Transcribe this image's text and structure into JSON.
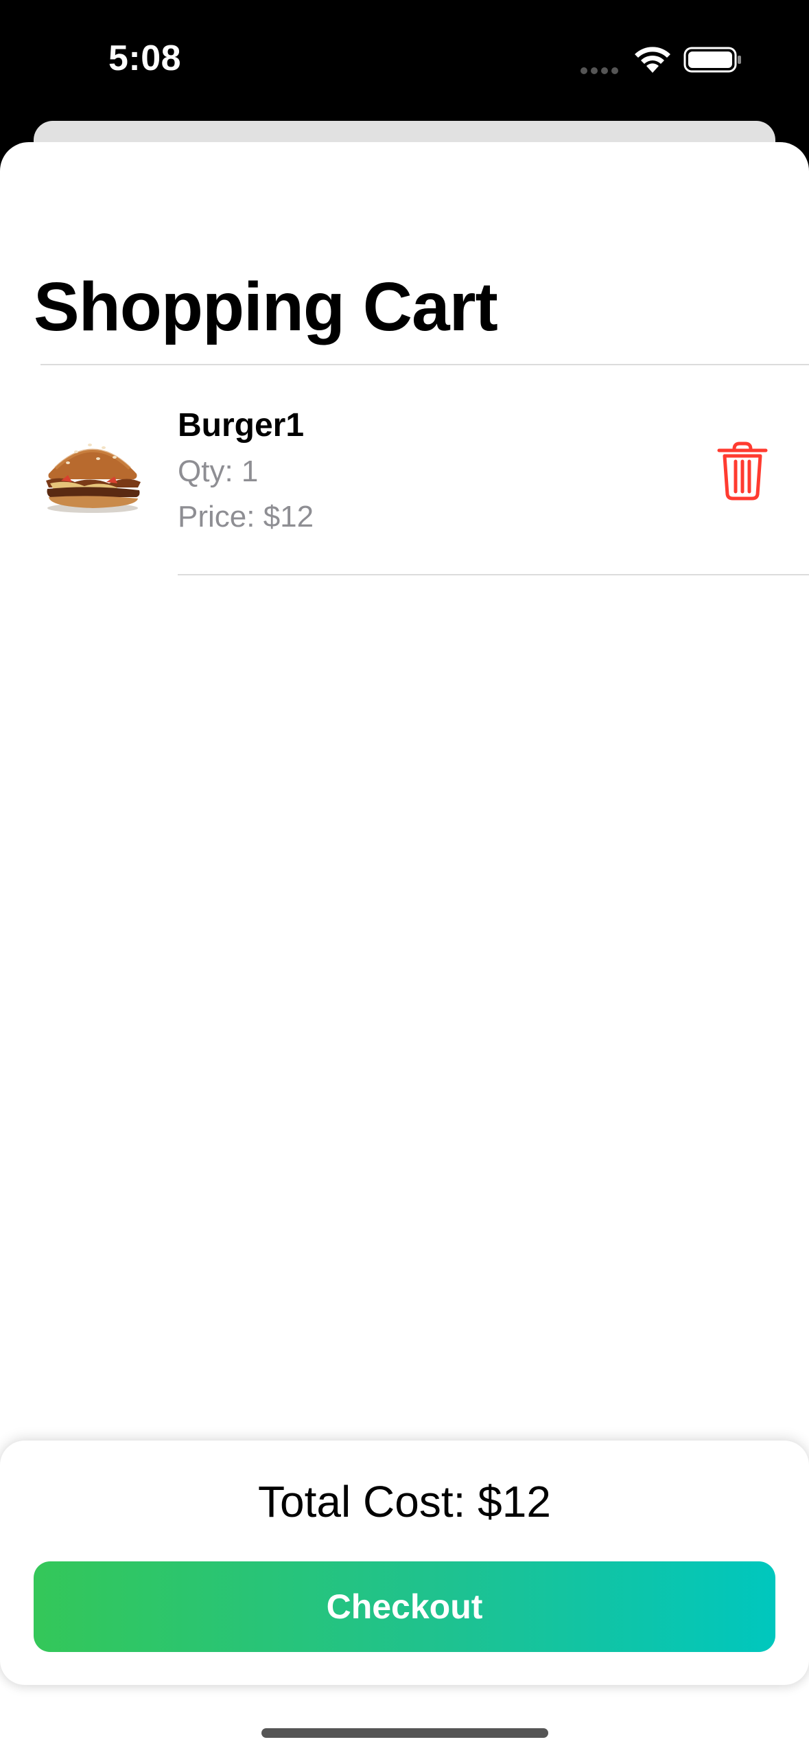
{
  "status_bar": {
    "time": "5:08"
  },
  "page": {
    "title": "Shopping Cart"
  },
  "cart": {
    "items": [
      {
        "name": "Burger1",
        "qty": "Qty: 1",
        "price": "Price: $12",
        "image_icon": "burger-image",
        "delete_icon": "trash-icon"
      }
    ]
  },
  "footer": {
    "total": "Total Cost: $12",
    "checkout_label": "Checkout"
  },
  "colors": {
    "delete": "#ff3b30",
    "checkout_start": "#34c759",
    "checkout_end": "#00c7be",
    "secondary_text": "#8e8e93"
  }
}
